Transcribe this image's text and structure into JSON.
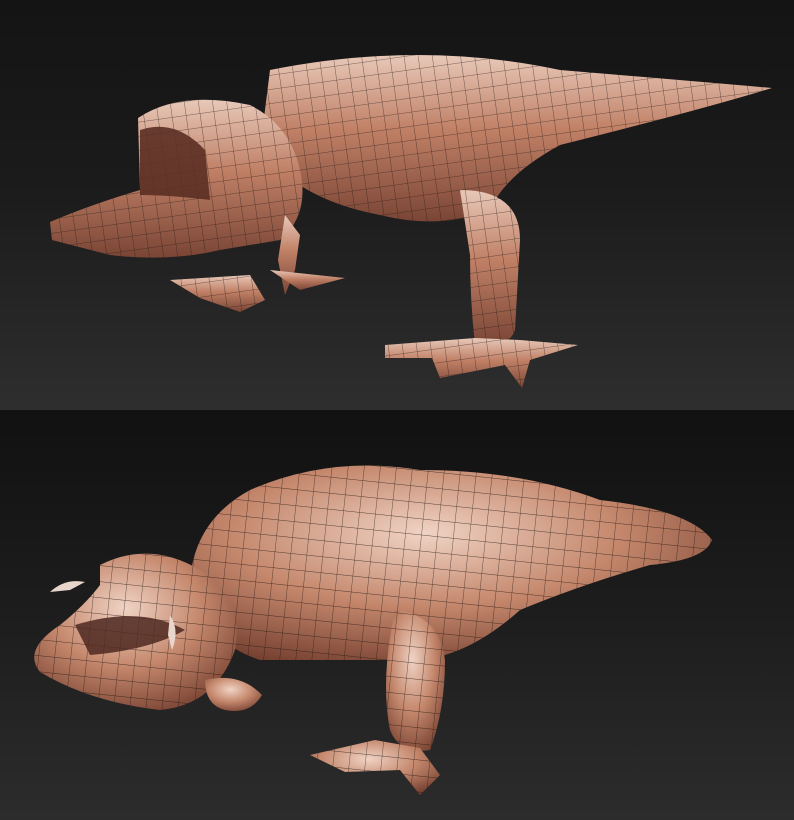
{
  "image": {
    "background_color": "#181818",
    "model_color": "#c9876f",
    "wire_color": "#1a1210",
    "panels": [
      {
        "subject": "low-poly-dinosaur-wireframe"
      },
      {
        "subject": "sculpted-dinosaur-wireframe"
      }
    ]
  }
}
